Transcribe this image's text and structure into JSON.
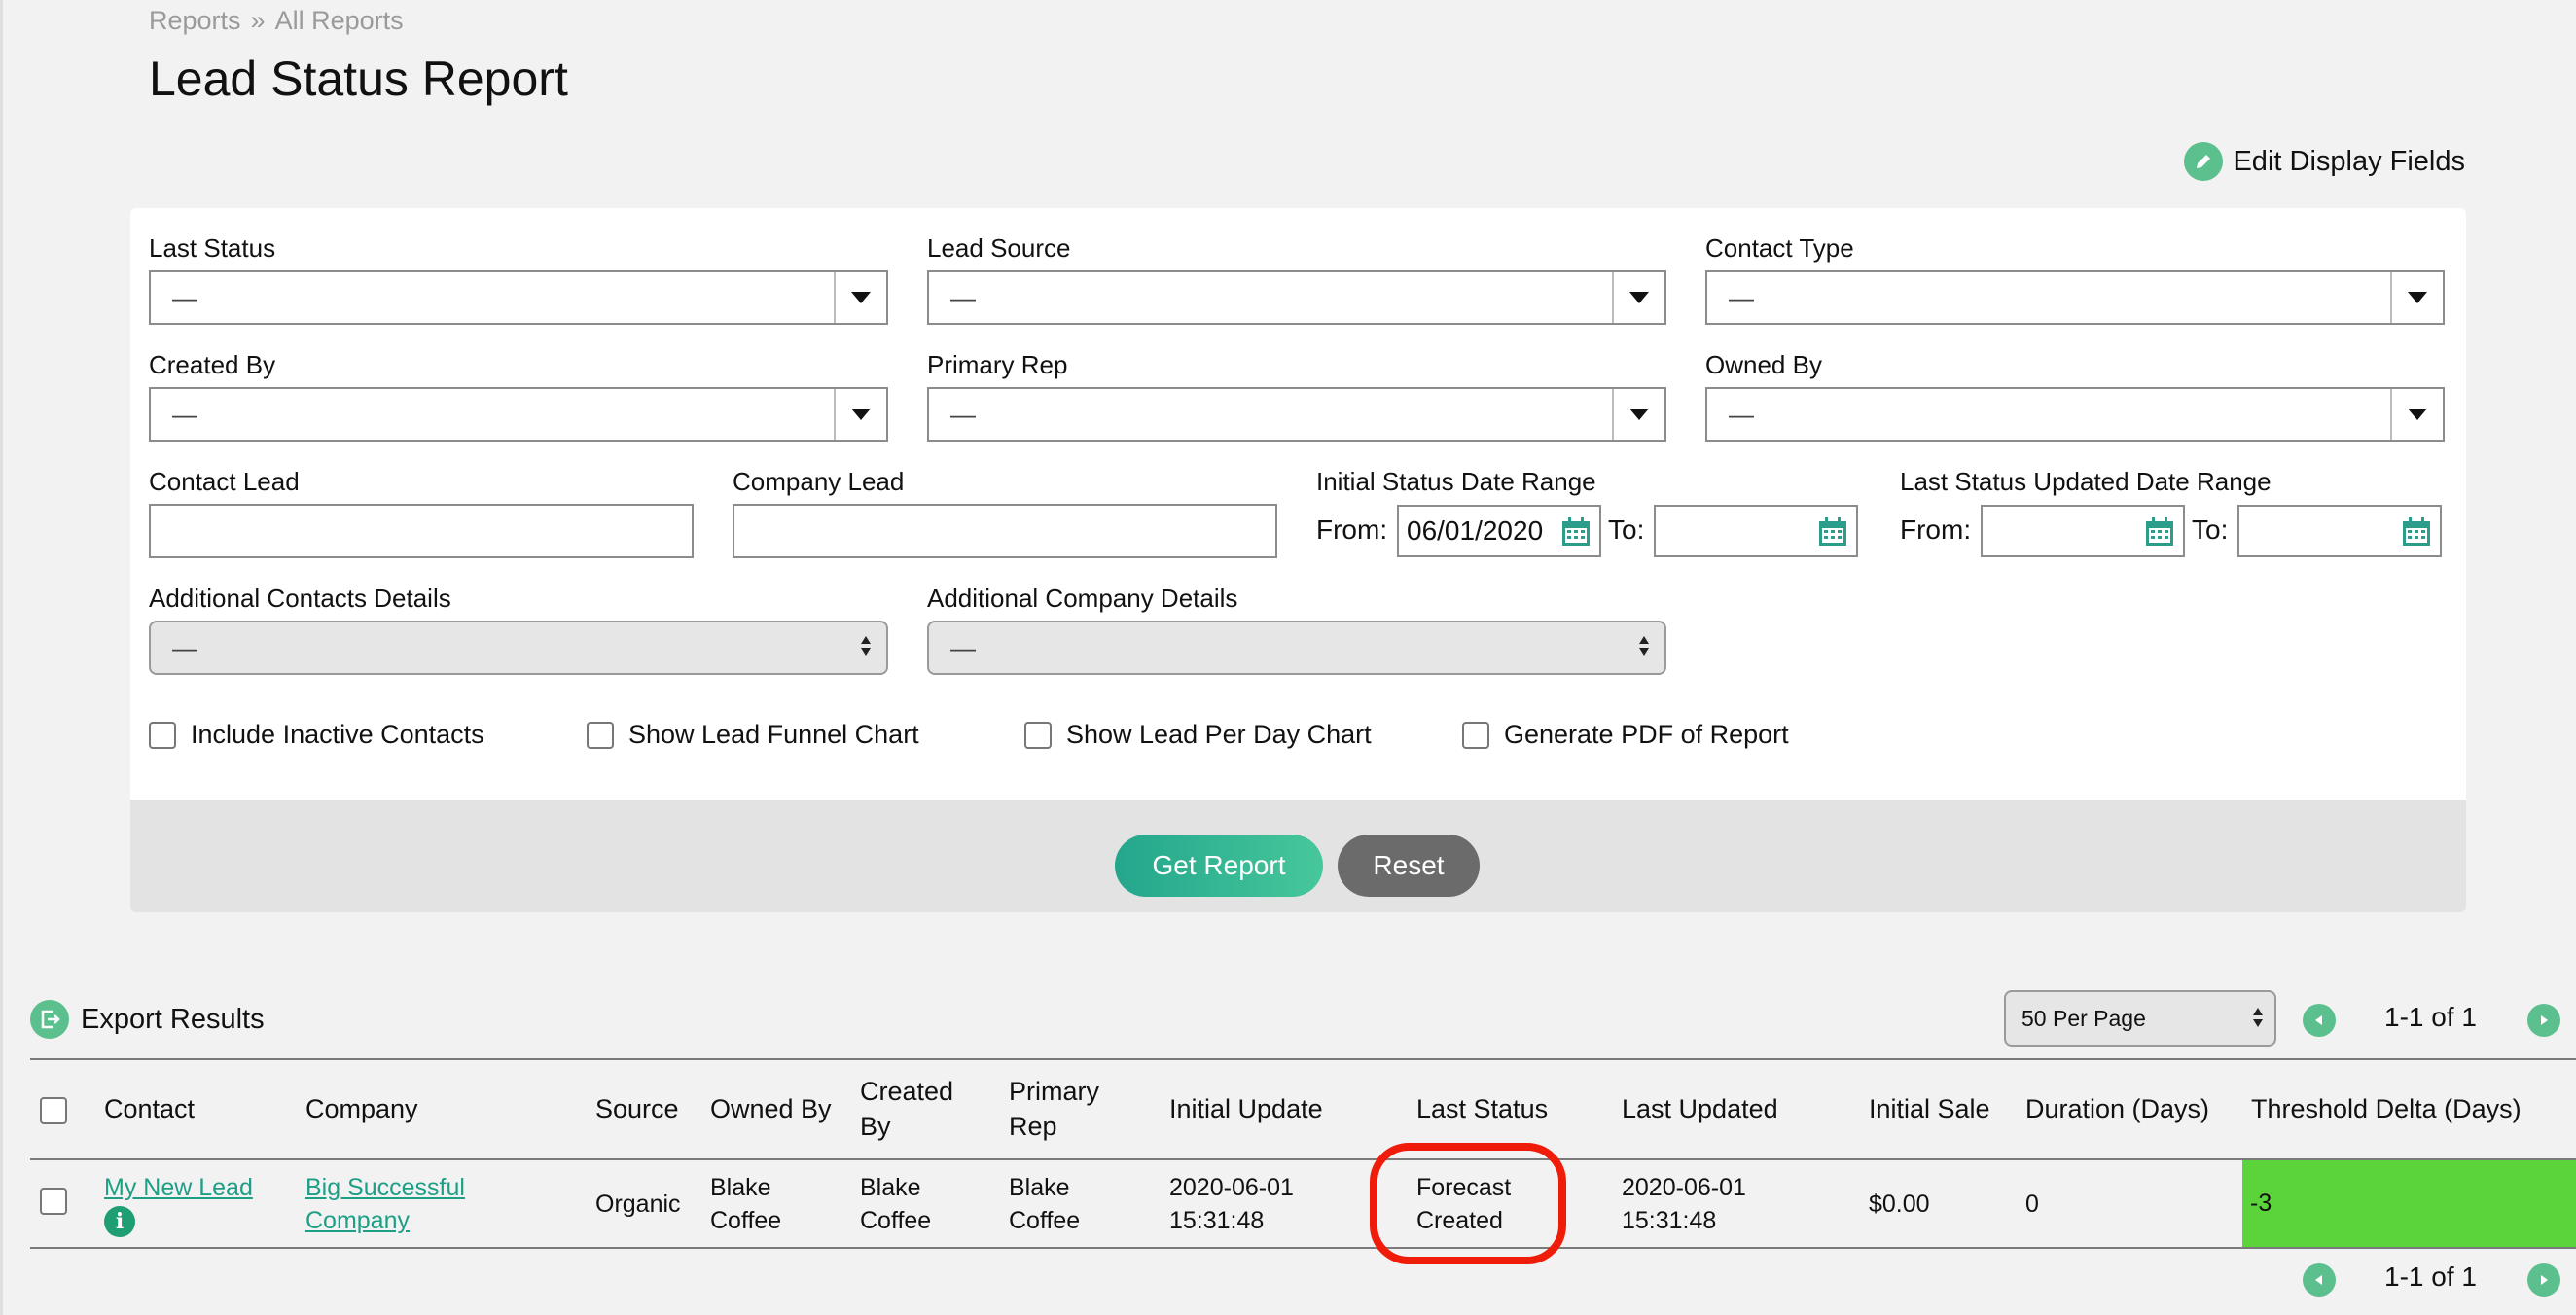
{
  "breadcrumb": {
    "root": "Reports",
    "separator": "»",
    "current": "All Reports"
  },
  "page_title": "Lead Status Report",
  "edit_display_fields": "Edit Display Fields",
  "filters": {
    "last_status": {
      "label": "Last Status",
      "value": "—"
    },
    "lead_source": {
      "label": "Lead Source",
      "value": "—"
    },
    "contact_type": {
      "label": "Contact Type",
      "value": "—"
    },
    "created_by": {
      "label": "Created By",
      "value": "—"
    },
    "primary_rep": {
      "label": "Primary Rep",
      "value": "—"
    },
    "owned_by": {
      "label": "Owned By",
      "value": "—"
    },
    "contact_lead": {
      "label": "Contact Lead",
      "value": ""
    },
    "company_lead": {
      "label": "Company Lead",
      "value": ""
    },
    "initial_status_range": {
      "label": "Initial Status Date Range",
      "from_label": "From:",
      "from_value": "06/01/2020",
      "to_label": "To:",
      "to_value": ""
    },
    "last_status_range": {
      "label": "Last Status Updated Date Range",
      "from_label": "From:",
      "from_value": "",
      "to_label": "To:",
      "to_value": ""
    },
    "additional_contacts": {
      "label": "Additional Contacts Details",
      "value": "—"
    },
    "additional_company": {
      "label": "Additional Company Details",
      "value": "—"
    }
  },
  "checkboxes": {
    "include_inactive": "Include Inactive Contacts",
    "funnel_chart": "Show Lead Funnel Chart",
    "per_day_chart": "Show Lead Per Day Chart",
    "generate_pdf": "Generate PDF of Report"
  },
  "buttons": {
    "get_report": "Get Report",
    "reset": "Reset"
  },
  "export_results": "Export Results",
  "pagination": {
    "per_page": "50 Per Page",
    "range_top": "1-1 of 1",
    "range_bottom": "1-1 of 1"
  },
  "table": {
    "headers": {
      "contact": "Contact",
      "company": "Company",
      "source": "Source",
      "owned_by": "Owned By",
      "created_by_1": "Created",
      "created_by_2": "By",
      "primary_rep_1": "Primary",
      "primary_rep_2": "Rep",
      "initial_update": "Initial Update",
      "last_status": "Last Status",
      "last_updated": "Last Updated",
      "initial_sale": "Initial Sale",
      "duration": "Duration (Days)",
      "threshold_delta": "Threshold Delta (Days)"
    },
    "row": {
      "contact": "My New Lead",
      "company_1": "Big Successful",
      "company_2": "Company",
      "source": "Organic",
      "owned_by_1": "Blake",
      "owned_by_2": "Coffee",
      "created_by_1": "Blake",
      "created_by_2": "Coffee",
      "primary_rep_1": "Blake",
      "primary_rep_2": "Coffee",
      "initial_update_1": "2020-06-01",
      "initial_update_2": "15:31:48",
      "last_status_1": "Forecast",
      "last_status_2": "Created",
      "last_updated_1": "2020-06-01",
      "last_updated_2": "15:31:48",
      "initial_sale": "$0.00",
      "duration": "0",
      "threshold_delta": "-3"
    }
  },
  "colors": {
    "accent": "#5cc08e",
    "link": "#1d9f86",
    "delta_positive": "#5ad43a",
    "highlight": "#f01c0a"
  },
  "icons": {
    "edit": "pencil-icon",
    "export": "export-icon",
    "calendar": "calendar-icon",
    "info": "info-icon"
  }
}
